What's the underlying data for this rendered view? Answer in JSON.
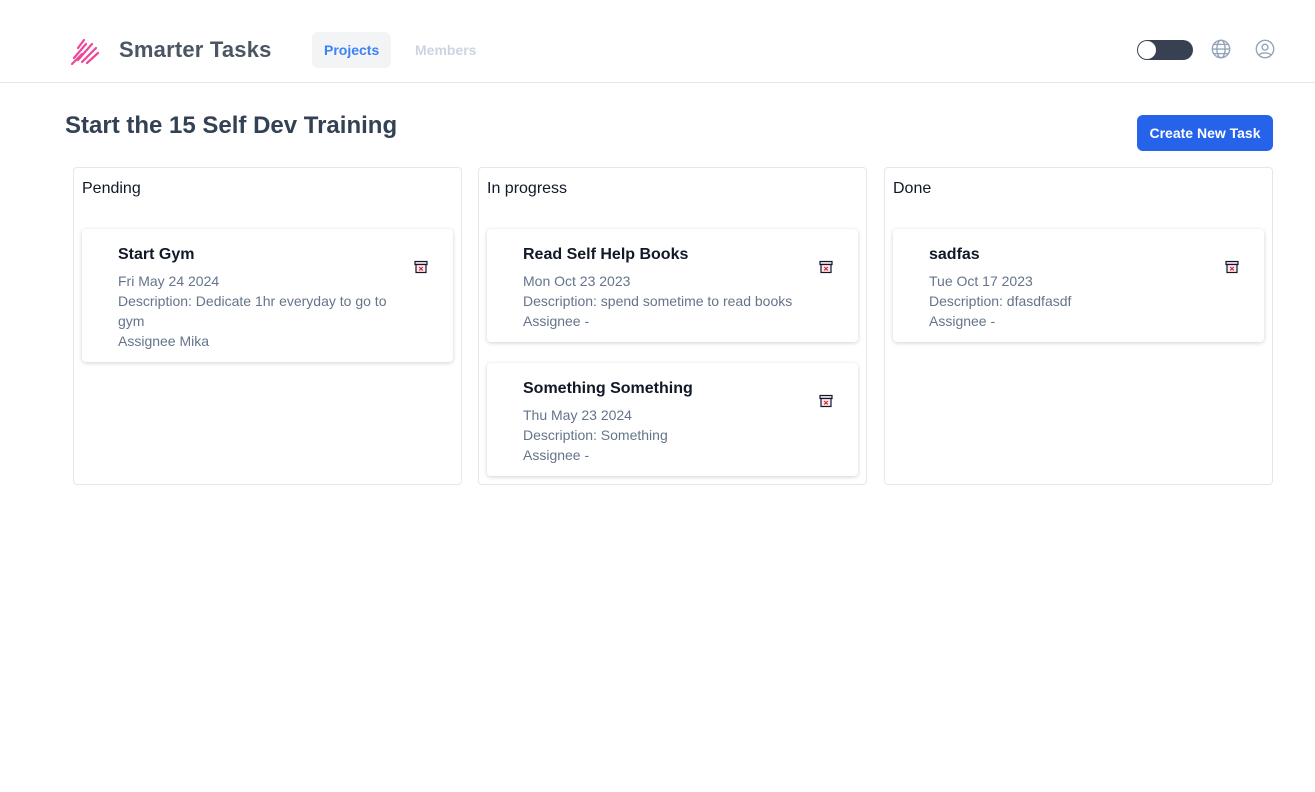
{
  "header": {
    "app_title": "Smarter Tasks",
    "nav": {
      "projects": "Projects",
      "members": "Members"
    },
    "brand_color": "#ec4899",
    "icons": [
      "logo-icon",
      "theme-toggle",
      "globe-icon",
      "user-icon"
    ]
  },
  "page": {
    "title": "Start the 15 Self Dev Training",
    "create_button": "Create New Task"
  },
  "columns": [
    {
      "title": "Pending",
      "cards": [
        {
          "title": "Start Gym",
          "date": "Fri May 24 2024",
          "description_line1": "Description: Dedicate 1hr everyday to go to",
          "description_line2": "gym",
          "assignee": "Assignee Mika"
        }
      ]
    },
    {
      "title": "In progress",
      "cards": [
        {
          "title": "Read Self Help Books",
          "date": "Mon Oct 23 2023",
          "description": "Description: spend sometime to read books",
          "assignee": "Assignee -"
        },
        {
          "title": "Something Something",
          "date": "Thu May 23 2024",
          "description": "Description: Something",
          "assignee": "Assignee -"
        }
      ]
    },
    {
      "title": "Done",
      "cards": [
        {
          "title": "sadfas",
          "date": "Tue Oct 17 2023",
          "description": "Description: dfasdfasdf",
          "assignee": "Assignee -"
        }
      ]
    }
  ]
}
